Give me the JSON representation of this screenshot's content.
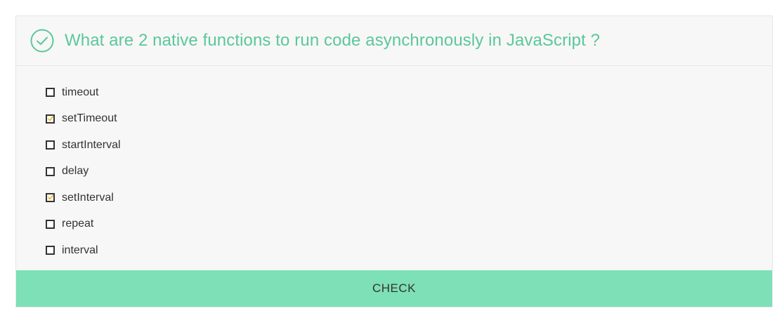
{
  "question": {
    "icon": "check-circle-icon",
    "text": "What are 2 native functions to run code asynchronously in JavaScript ?"
  },
  "options": [
    {
      "label": "timeout",
      "checked": false
    },
    {
      "label": "setTimeout",
      "checked": true
    },
    {
      "label": "startInterval",
      "checked": false
    },
    {
      "label": "delay",
      "checked": false
    },
    {
      "label": "setInterval",
      "checked": true
    },
    {
      "label": "repeat",
      "checked": false
    },
    {
      "label": "interval",
      "checked": false
    }
  ],
  "actions": {
    "check_label": "CHECK"
  },
  "colors": {
    "accent": "#5cc79a",
    "button_bg": "#7ee0b6",
    "tick": "#e8b400"
  }
}
